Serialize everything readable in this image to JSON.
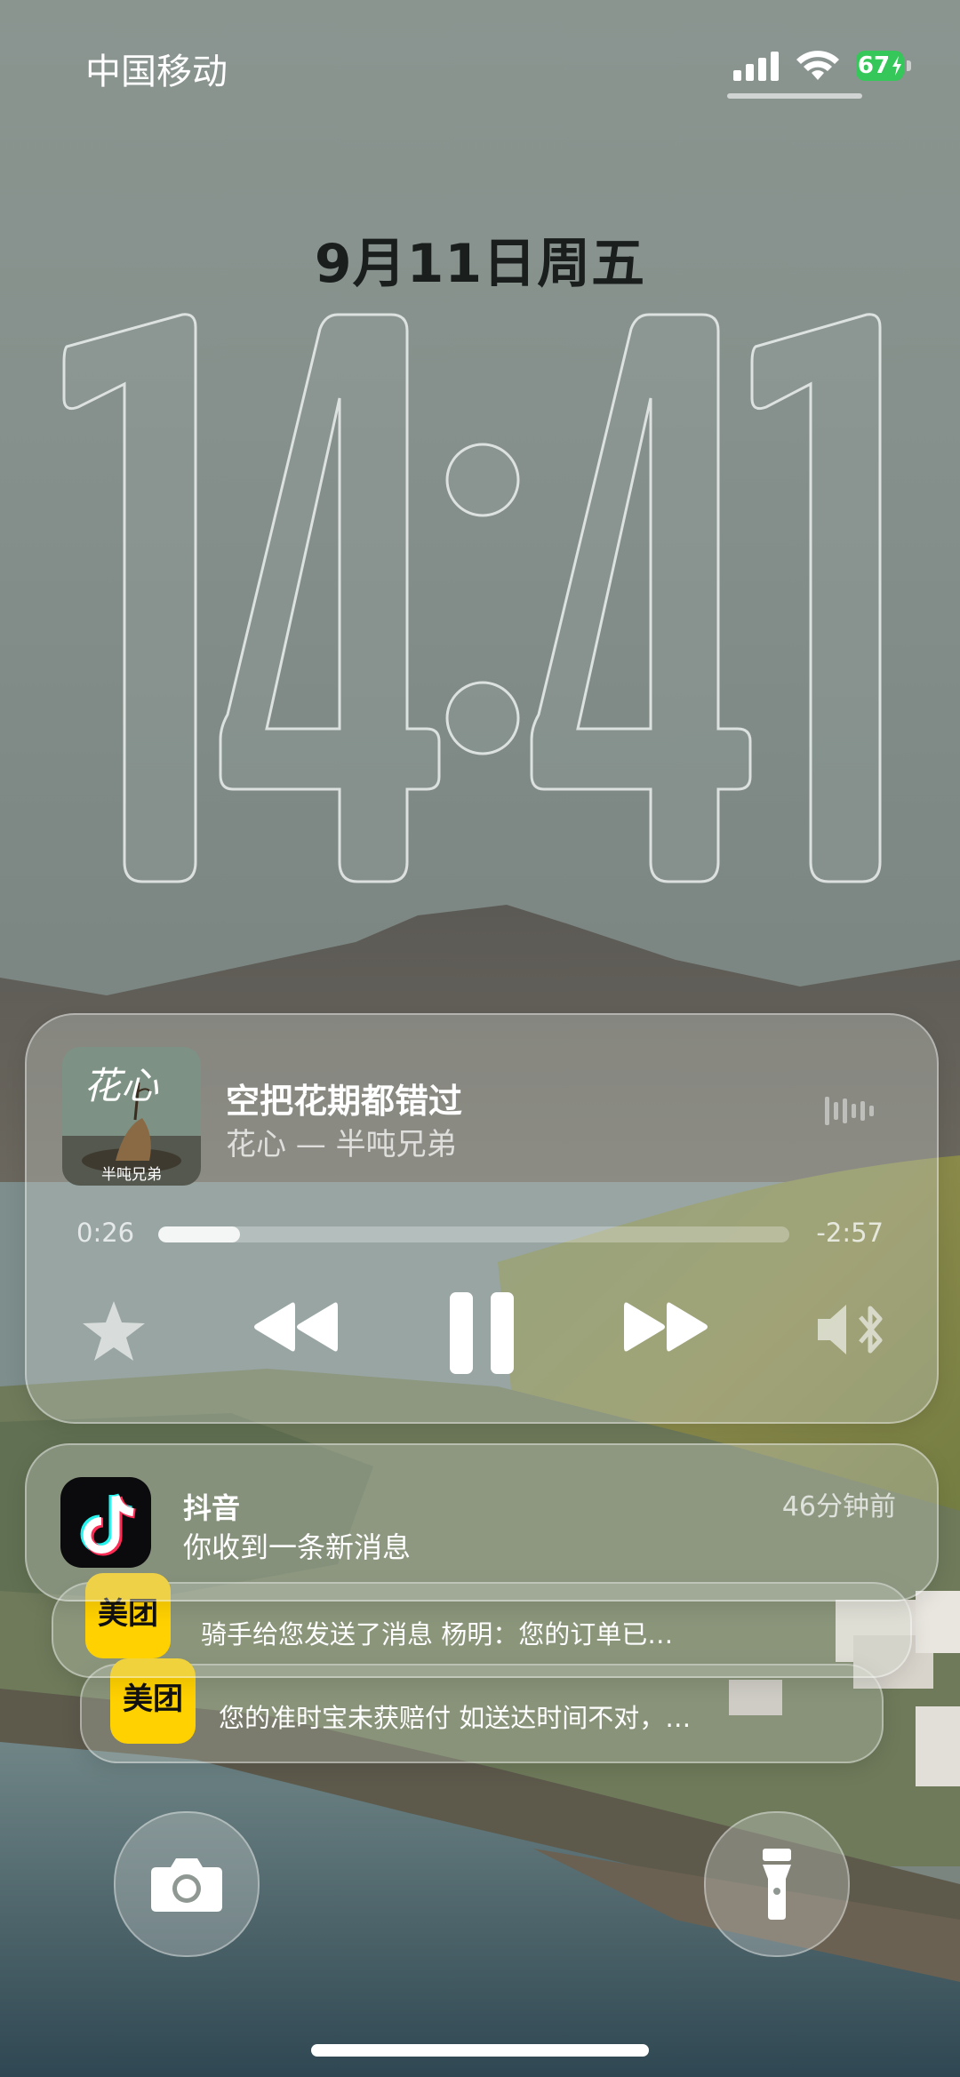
{
  "status_bar": {
    "carrier": "中国移动",
    "battery_percent": "67",
    "battery_color": "#35c759",
    "icons": [
      "signal-icon",
      "wifi-icon",
      "charging-bolt-icon"
    ]
  },
  "lock_screen": {
    "date": "9月11日周五",
    "clock": {
      "hours": "14",
      "minutes": "41"
    }
  },
  "now_playing": {
    "album_art_text": "花心",
    "album_art_caption": "半吨兄弟",
    "song_title": "空把花期都错过",
    "song_subtitle": "花心 — 半吨兄弟",
    "elapsed": "0:26",
    "remaining": "-2:57",
    "progress_fraction": 0.13,
    "controls": [
      "star-icon",
      "rewind-icon",
      "pause-icon",
      "fast-forward-icon",
      "audio-output-icon"
    ]
  },
  "notifications": {
    "primary": {
      "app": "抖音",
      "message": "你收到一条新消息",
      "time": "46分钟前",
      "icon": "douyin-icon"
    },
    "stacked": [
      {
        "app_icon_text": "美团",
        "text": "骑手给您发送了消息  杨明：您的订单已…"
      },
      {
        "app_icon_text": "美团",
        "text": "您的准时宝未获赔付  如送达时间不对，…"
      }
    ]
  },
  "quick_actions": [
    "camera-icon",
    "flashlight-icon"
  ]
}
